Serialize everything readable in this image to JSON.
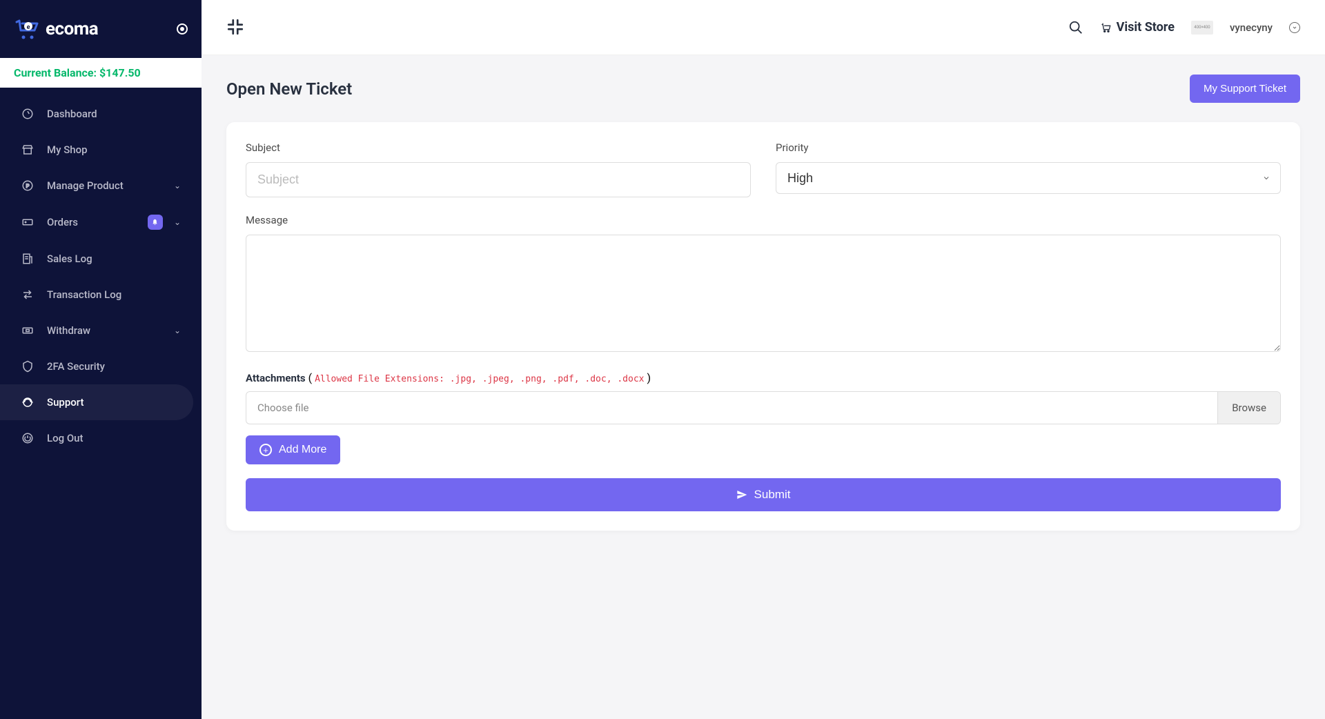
{
  "brand": {
    "name": "ecoma"
  },
  "balance": {
    "label": "Current Balance: $147.50"
  },
  "sidebar": {
    "items": [
      {
        "label": "Dashboard"
      },
      {
        "label": "My Shop"
      },
      {
        "label": "Manage Product"
      },
      {
        "label": "Orders"
      },
      {
        "label": "Sales Log"
      },
      {
        "label": "Transaction Log"
      },
      {
        "label": "Withdraw"
      },
      {
        "label": "2FA Security"
      },
      {
        "label": "Support"
      },
      {
        "label": "Log Out"
      }
    ]
  },
  "topbar": {
    "visit_store": "Visit Store",
    "username": "vynecyny",
    "avatar_text": "400×400"
  },
  "page": {
    "title": "Open New Ticket",
    "my_ticket_btn": "My Support Ticket"
  },
  "form": {
    "subject_label": "Subject",
    "subject_placeholder": "Subject",
    "priority_label": "Priority",
    "priority_value": "High",
    "message_label": "Message",
    "attachments_label": "Attachments",
    "attachments_hint": "Allowed File Extensions: .jpg, .jpeg, .png, .pdf, .doc, .docx",
    "choose_file": "Choose file",
    "browse": "Browse",
    "add_more": "Add More",
    "submit": "Submit"
  }
}
